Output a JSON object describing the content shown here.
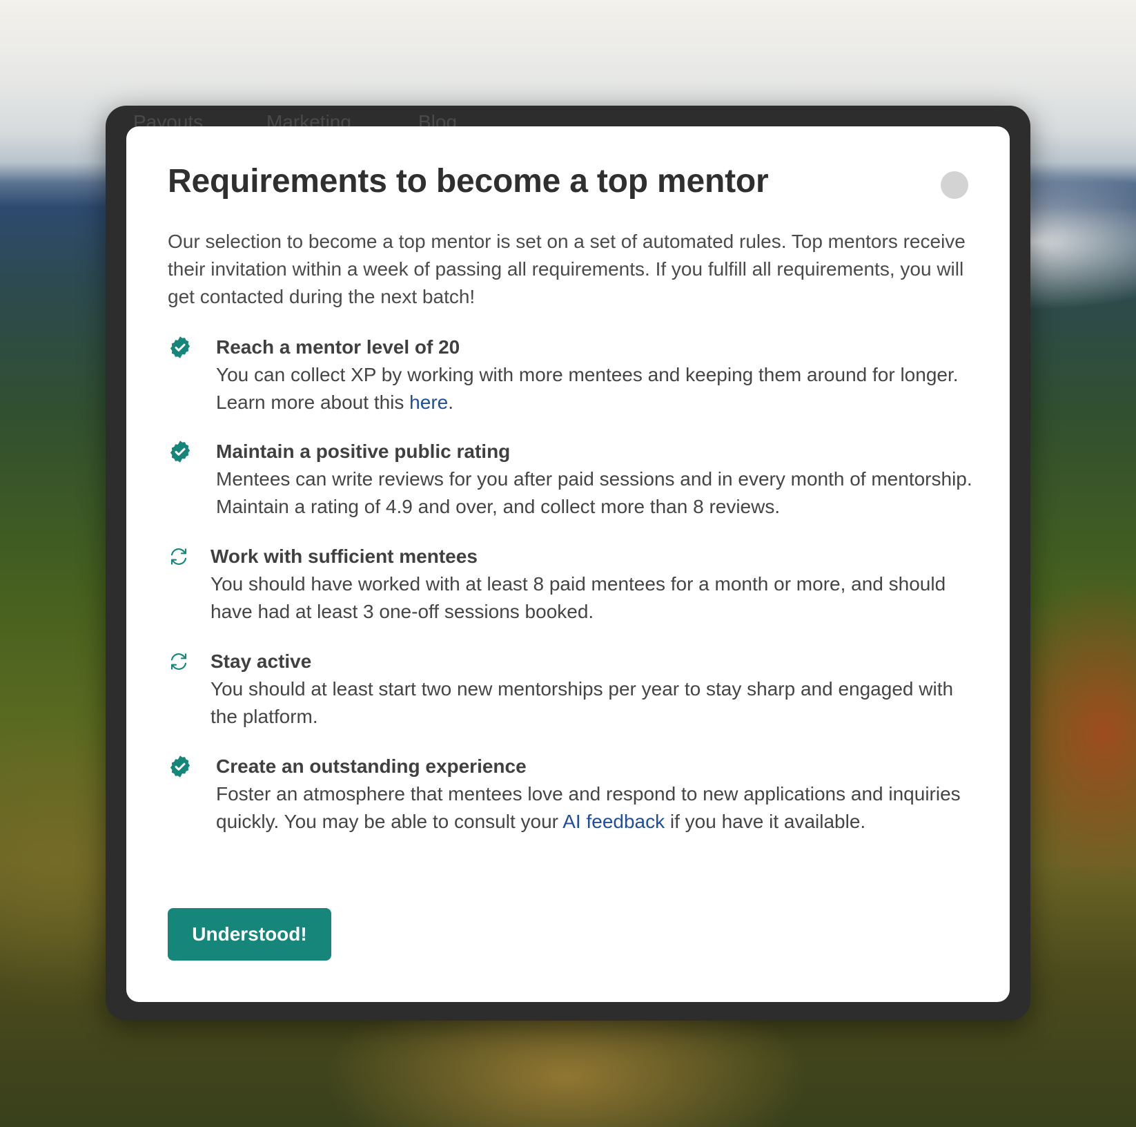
{
  "background_nav": [
    "Payouts",
    "Marketing",
    "Blog"
  ],
  "modal": {
    "title": "Requirements to become a top mentor",
    "intro": "Our selection to become a top mentor is set on a set of automated rules. Top mentors receive their invitation within a week of passing all requirements. If you fulfill all requirements, you will get contacted during the next batch!",
    "requirements": [
      {
        "status": "done",
        "icon": "check-badge-icon",
        "title": "Reach a mentor level of 20",
        "desc_before": "You can collect XP by working with more mentees and keeping them around for longer. Learn more about this ",
        "link": "here",
        "desc_after": "."
      },
      {
        "status": "done",
        "icon": "check-badge-icon",
        "title": "Maintain a positive public rating",
        "desc_before": "Mentees can write reviews for you after paid sessions and in every month of mentorship. Maintain a rating of 4.9 and over, and collect more than 8 reviews.",
        "link": "",
        "desc_after": ""
      },
      {
        "status": "in-progress",
        "icon": "refresh-icon",
        "title": "Work with sufficient mentees",
        "desc_before": "You should have worked with at least 8 paid mentees for a month or more, and should have had at least 3 one-off sessions booked.",
        "link": "",
        "desc_after": ""
      },
      {
        "status": "in-progress",
        "icon": "refresh-icon",
        "title": "Stay active",
        "desc_before": "You should at least start two new mentorships per year to stay sharp and engaged with the platform.",
        "link": "",
        "desc_after": ""
      },
      {
        "status": "done",
        "icon": "check-badge-icon",
        "title": "Create an outstanding experience",
        "desc_before": "Foster an atmosphere that mentees love and respond to new applications and inquiries quickly. You may be able to consult your ",
        "link": "AI feedback",
        "desc_after": " if you have it available."
      }
    ],
    "confirm_label": "Understood!"
  },
  "colors": {
    "accent": "#16857a",
    "link": "#1f4e9c",
    "title": "#2f2f2f"
  }
}
